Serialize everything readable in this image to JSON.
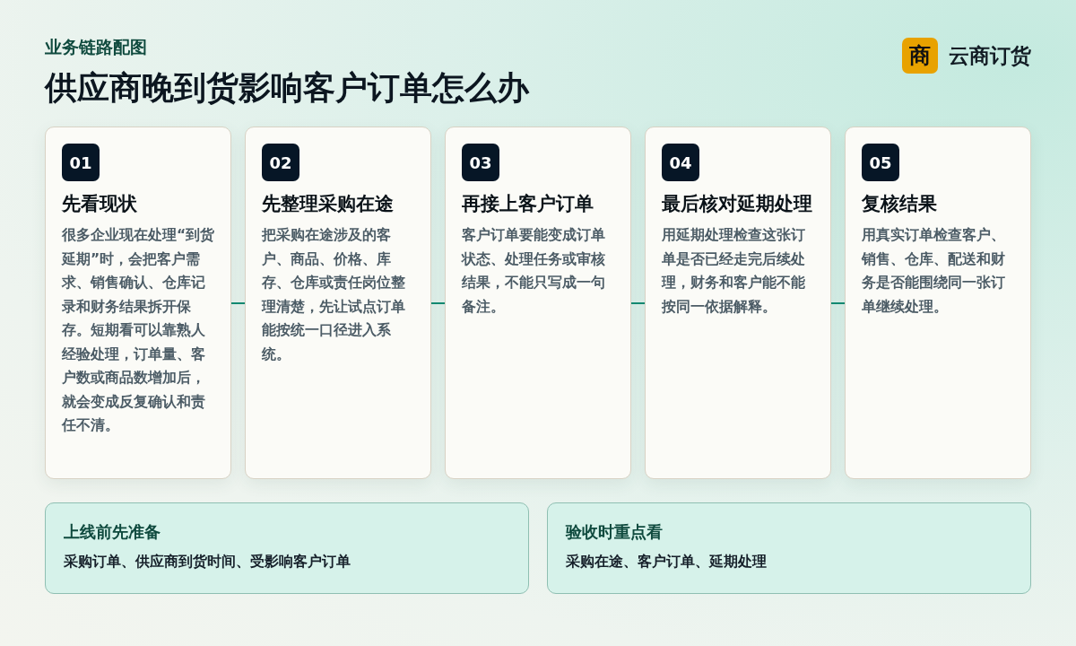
{
  "header": {
    "kicker": "业务链路配图",
    "title": "供应商晚到货影响客户订单怎么办"
  },
  "brand": {
    "mark": "商",
    "name": "云商订货"
  },
  "steps": [
    {
      "number": "01",
      "title": "先看现状",
      "body": "很多企业现在处理“到货延期”时，会把客户需求、销售确认、仓库记录和财务结果拆开保存。短期看可以靠熟人经验处理，订单量、客户数或商品数增加后，就会变成反复确认和责任不清。"
    },
    {
      "number": "02",
      "title": "先整理采购在途",
      "body": "把采购在途涉及的客户、商品、价格、库存、仓库或责任岗位整理清楚，先让试点订单能按统一口径进入系统。"
    },
    {
      "number": "03",
      "title": "再接上客户订单",
      "body": "客户订单要能变成订单状态、处理任务或审核结果，不能只写成一句备注。"
    },
    {
      "number": "04",
      "title": "最后核对延期处理",
      "body": "用延期处理检查这张订单是否已经走完后续处理，财务和客户能不能按同一依据解释。"
    },
    {
      "number": "05",
      "title": "复核结果",
      "body": "用真实订单检查客户、销售、仓库、配送和财务是否能围绕同一张订单继续处理。"
    }
  ],
  "notes": [
    {
      "title": "上线前先准备",
      "body": "采购订单、供应商到货时间、受影响客户订单"
    },
    {
      "title": "验收时重点看",
      "body": "采购在途、客户订单、延期处理"
    }
  ]
}
